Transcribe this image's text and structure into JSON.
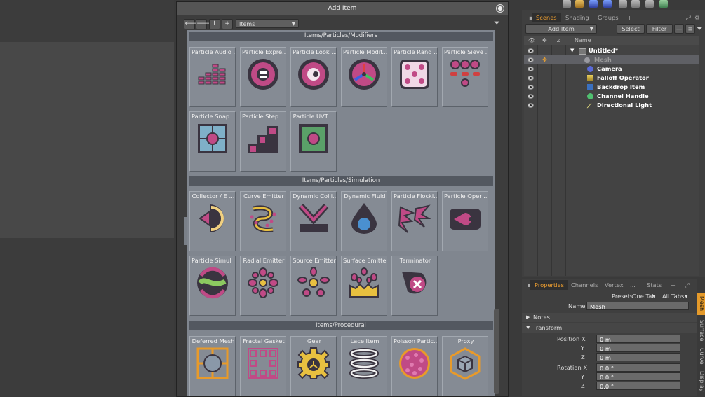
{
  "dialog": {
    "title": "Add Item",
    "toolbar": {
      "back": "🡐",
      "forward": "🡒",
      "up": "t",
      "add": "+",
      "select_value": "Items"
    }
  },
  "categories": [
    {
      "title": "Items/Particles/Modifiers",
      "items": [
        {
          "label": "Particle Audio ...",
          "icon": "equalizer-icon"
        },
        {
          "label": "Particle Expre...",
          "icon": "equals-circle-icon"
        },
        {
          "label": "Particle Look ...",
          "icon": "eye-circle-icon"
        },
        {
          "label": "Particle Modif...",
          "icon": "tri-color-circle-icon"
        },
        {
          "label": "Particle Rand ...",
          "icon": "dice-icon"
        },
        {
          "label": "Particle Sieve ...",
          "icon": "sieve-dots-icon"
        },
        {
          "label": "Particle Snap ...",
          "icon": "grid-snap-icon"
        },
        {
          "label": "Particle Step ...",
          "icon": "stairs-icon"
        },
        {
          "label": "Particle UVT ...",
          "icon": "uvt-square-icon"
        }
      ]
    },
    {
      "title": "Items/Particles/Simulation",
      "items": [
        {
          "label": "Collector / E ...",
          "icon": "collector-icon"
        },
        {
          "label": "Curve Emitter",
          "icon": "curve-emitter-icon"
        },
        {
          "label": "Dynamic Colli...",
          "icon": "collision-icon"
        },
        {
          "label": "Dynamic Fluid",
          "icon": "fluid-drop-icon"
        },
        {
          "label": "Particle Flocki...",
          "icon": "flocking-icon"
        },
        {
          "label": "Particle Oper ...",
          "icon": "operator-icon"
        },
        {
          "label": "Particle Simul ...",
          "icon": "simulation-icon"
        },
        {
          "label": "Radial Emitter",
          "icon": "radial-emitter-icon"
        },
        {
          "label": "Source Emitter",
          "icon": "source-emitter-icon"
        },
        {
          "label": "Surface Emitter",
          "icon": "surface-emitter-icon"
        },
        {
          "label": "Terminator",
          "icon": "terminator-icon"
        }
      ]
    },
    {
      "title": "Items/Procedural",
      "items": [
        {
          "label": "Deferred Mesh",
          "icon": "deferred-mesh-icon"
        },
        {
          "label": "Fractal Gasket",
          "icon": "fractal-gasket-icon"
        },
        {
          "label": "Gear",
          "icon": "gear-icon"
        },
        {
          "label": "Lace Item",
          "icon": "lace-icon"
        },
        {
          "label": "Poisson Partic...",
          "icon": "poisson-icon"
        },
        {
          "label": "Proxy",
          "icon": "proxy-cube-icon"
        }
      ]
    }
  ],
  "scene": {
    "tabs": [
      "Scenes",
      "Shading",
      "Groups",
      "+"
    ],
    "add_item": "Add Item",
    "select": "Select",
    "filter": "Filter",
    "column_name": "Name",
    "items": [
      {
        "label": "Untitled*",
        "icon": "scene-icon"
      },
      {
        "label": "Mesh",
        "icon": "mesh-icon"
      },
      {
        "label": "Camera",
        "icon": "camera-icon"
      },
      {
        "label": "Falloff Operator",
        "icon": "falloff-icon"
      },
      {
        "label": "Backdrop Item",
        "icon": "backdrop-icon"
      },
      {
        "label": "Channel Handle",
        "icon": "handle-icon"
      },
      {
        "label": "Directional Light",
        "icon": "light-icon"
      }
    ]
  },
  "properties": {
    "tabs": [
      "Properties",
      "Channels",
      "Vertex",
      "...",
      "Stats",
      "+"
    ],
    "presets": "Presets",
    "one_tab": "One Tab",
    "all_tabs": "All Tabs",
    "name_label": "Name",
    "name_value": "Mesh",
    "notes": "Notes",
    "transform": "Transform",
    "position_label": "Position X",
    "y_label": "Y",
    "z_label": "Z",
    "rotation_label": "Rotation X",
    "pos": [
      "0 m",
      "0 m",
      "0 m"
    ],
    "rot": [
      "0.0 °",
      "0.0 °",
      "0.0 °"
    ],
    "side_tabs": [
      "Mesh",
      "Surface",
      "Curve",
      "Display"
    ]
  },
  "colors": {
    "accent": "#e59a2a",
    "icon_magenta": "#c04a86",
    "icon_dark": "#3a3440",
    "icon_yellow": "#e8c040"
  }
}
